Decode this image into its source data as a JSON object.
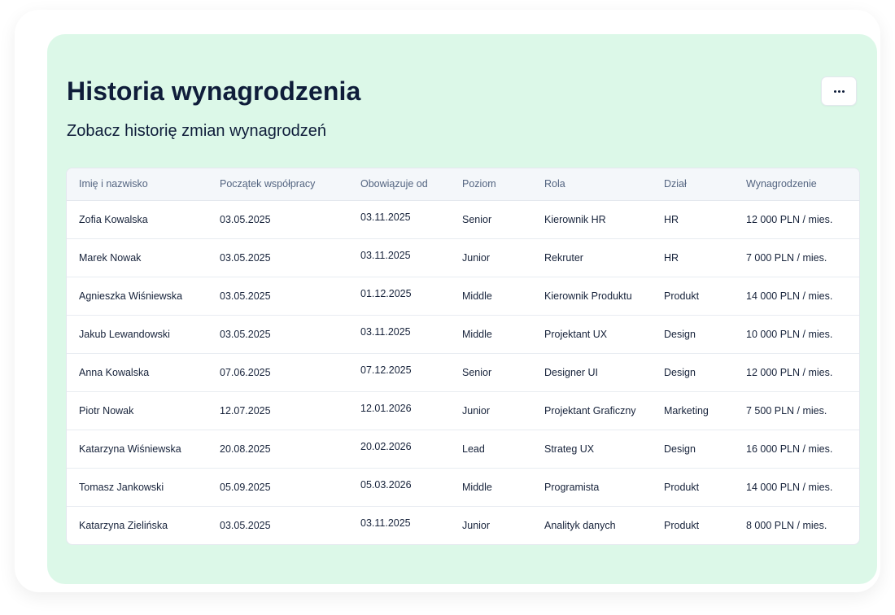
{
  "header": {
    "title": "Historia wynagrodzenia",
    "subtitle": "Zobacz historię zmian wynagrodzeń",
    "more_icon": "more-horizontal-icon"
  },
  "table": {
    "columns": [
      "Imię i nazwisko",
      "Początek współpracy",
      "Obowiązuje od",
      "Poziom",
      "Rola",
      "Dział",
      "Wynagrodzenie"
    ],
    "rows": [
      [
        "Zofia Kowalska",
        "03.05.2025",
        "03.11.2025",
        "Senior",
        "Kierownik HR",
        "HR",
        "12 000 PLN / mies."
      ],
      [
        "Marek Nowak",
        "03.05.2025",
        "03.11.2025",
        "Junior",
        "Rekruter",
        "HR",
        "7 000 PLN / mies."
      ],
      [
        "Agnieszka Wiśniewska",
        "03.05.2025",
        "01.12.2025",
        "Middle",
        "Kierownik Produktu",
        "Produkt",
        "14 000 PLN / mies."
      ],
      [
        "Jakub Lewandowski",
        "03.05.2025",
        "03.11.2025",
        "Middle",
        "Projektant UX",
        "Design",
        "10 000 PLN / mies."
      ],
      [
        "Anna Kowalska",
        "07.06.2025",
        "07.12.2025",
        "Senior",
        "Designer UI",
        "Design",
        "12 000 PLN / mies."
      ],
      [
        "Piotr Nowak",
        "12.07.2025",
        "12.01.2026",
        "Junior",
        "Projektant Graficzny",
        "Marketing",
        "7 500 PLN / mies."
      ],
      [
        "Katarzyna Wiśniewska",
        "20.08.2025",
        "20.02.2026",
        "Lead",
        "Strateg UX",
        "Design",
        "16 000 PLN / mies."
      ],
      [
        "Tomasz Jankowski",
        "05.09.2025",
        "05.03.2026",
        "Middle",
        "Programista",
        "Produkt",
        "14 000 PLN / mies."
      ],
      [
        "Katarzyna Zielińska",
        "03.05.2025",
        "03.11.2025",
        "Junior",
        "Analityk danych",
        "Produkt",
        "8 000 PLN / mies."
      ]
    ]
  },
  "colors": {
    "card_background": "#dcf8e8",
    "title_text": "#0f1d3a",
    "header_row_background": "#f4f7fa"
  }
}
